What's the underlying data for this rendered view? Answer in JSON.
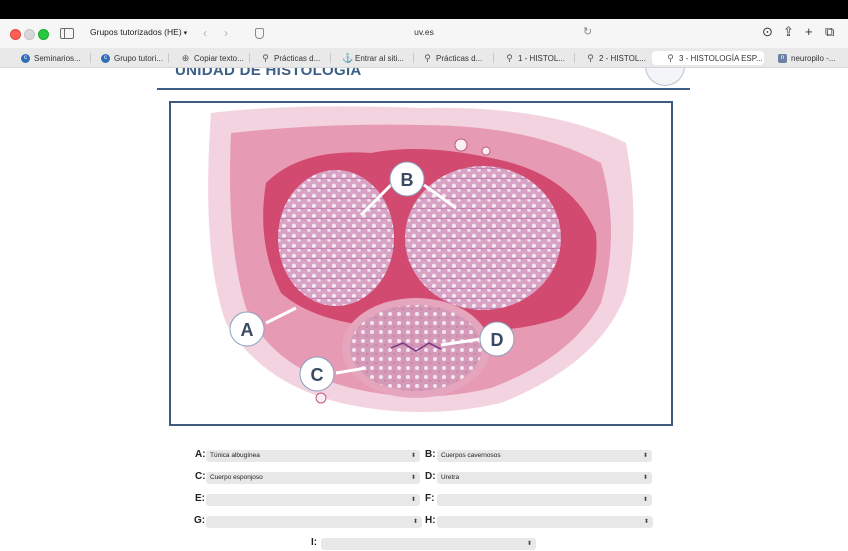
{
  "browser": {
    "group_label": "Grupos tutorizados (HE)",
    "url": "uv.es",
    "tabs": [
      {
        "label": "Seminarios...",
        "icon": "c-icon"
      },
      {
        "label": "Grupo tutori...",
        "icon": "c-icon"
      },
      {
        "label": "Copiar texto...",
        "icon": "globe-icon"
      },
      {
        "label": "Prácticas d...",
        "icon": "pin-icon"
      },
      {
        "label": "Entrar al siti...",
        "icon": "hook-icon"
      },
      {
        "label": "Prácticas d...",
        "icon": "pin-icon"
      },
      {
        "label": "1 - HISTOL...",
        "icon": "pin-icon"
      },
      {
        "label": "2 - HISTOL...",
        "icon": "pin-icon"
      },
      {
        "label": "3 - HISTOLOGÍA ESP...",
        "icon": "pin-icon",
        "active": true
      },
      {
        "label": "neuropilo -...",
        "icon": "n-icon"
      }
    ]
  },
  "page": {
    "heading": "UNIDAD DE HISTOLOGÍA",
    "figure": {
      "labels": {
        "a": "A",
        "b": "B",
        "c": "C",
        "d": "D"
      }
    },
    "questions": [
      {
        "label": "A:",
        "value": ""
      },
      {
        "label": "B:",
        "value": ""
      },
      {
        "label": "C:",
        "value": ""
      },
      {
        "label": "D:",
        "value": ""
      },
      {
        "label": "E:",
        "value": ""
      },
      {
        "label": "F:",
        "value": ""
      },
      {
        "label": "G:",
        "value": ""
      },
      {
        "label": "H:",
        "value": ""
      },
      {
        "label": "I:",
        "value": ""
      }
    ],
    "answers": {
      "a": "Túnica albugínea",
      "b": "Cuerpos cavernosos",
      "c": "Cuerpo esponjoso",
      "d": "Uretra"
    }
  }
}
